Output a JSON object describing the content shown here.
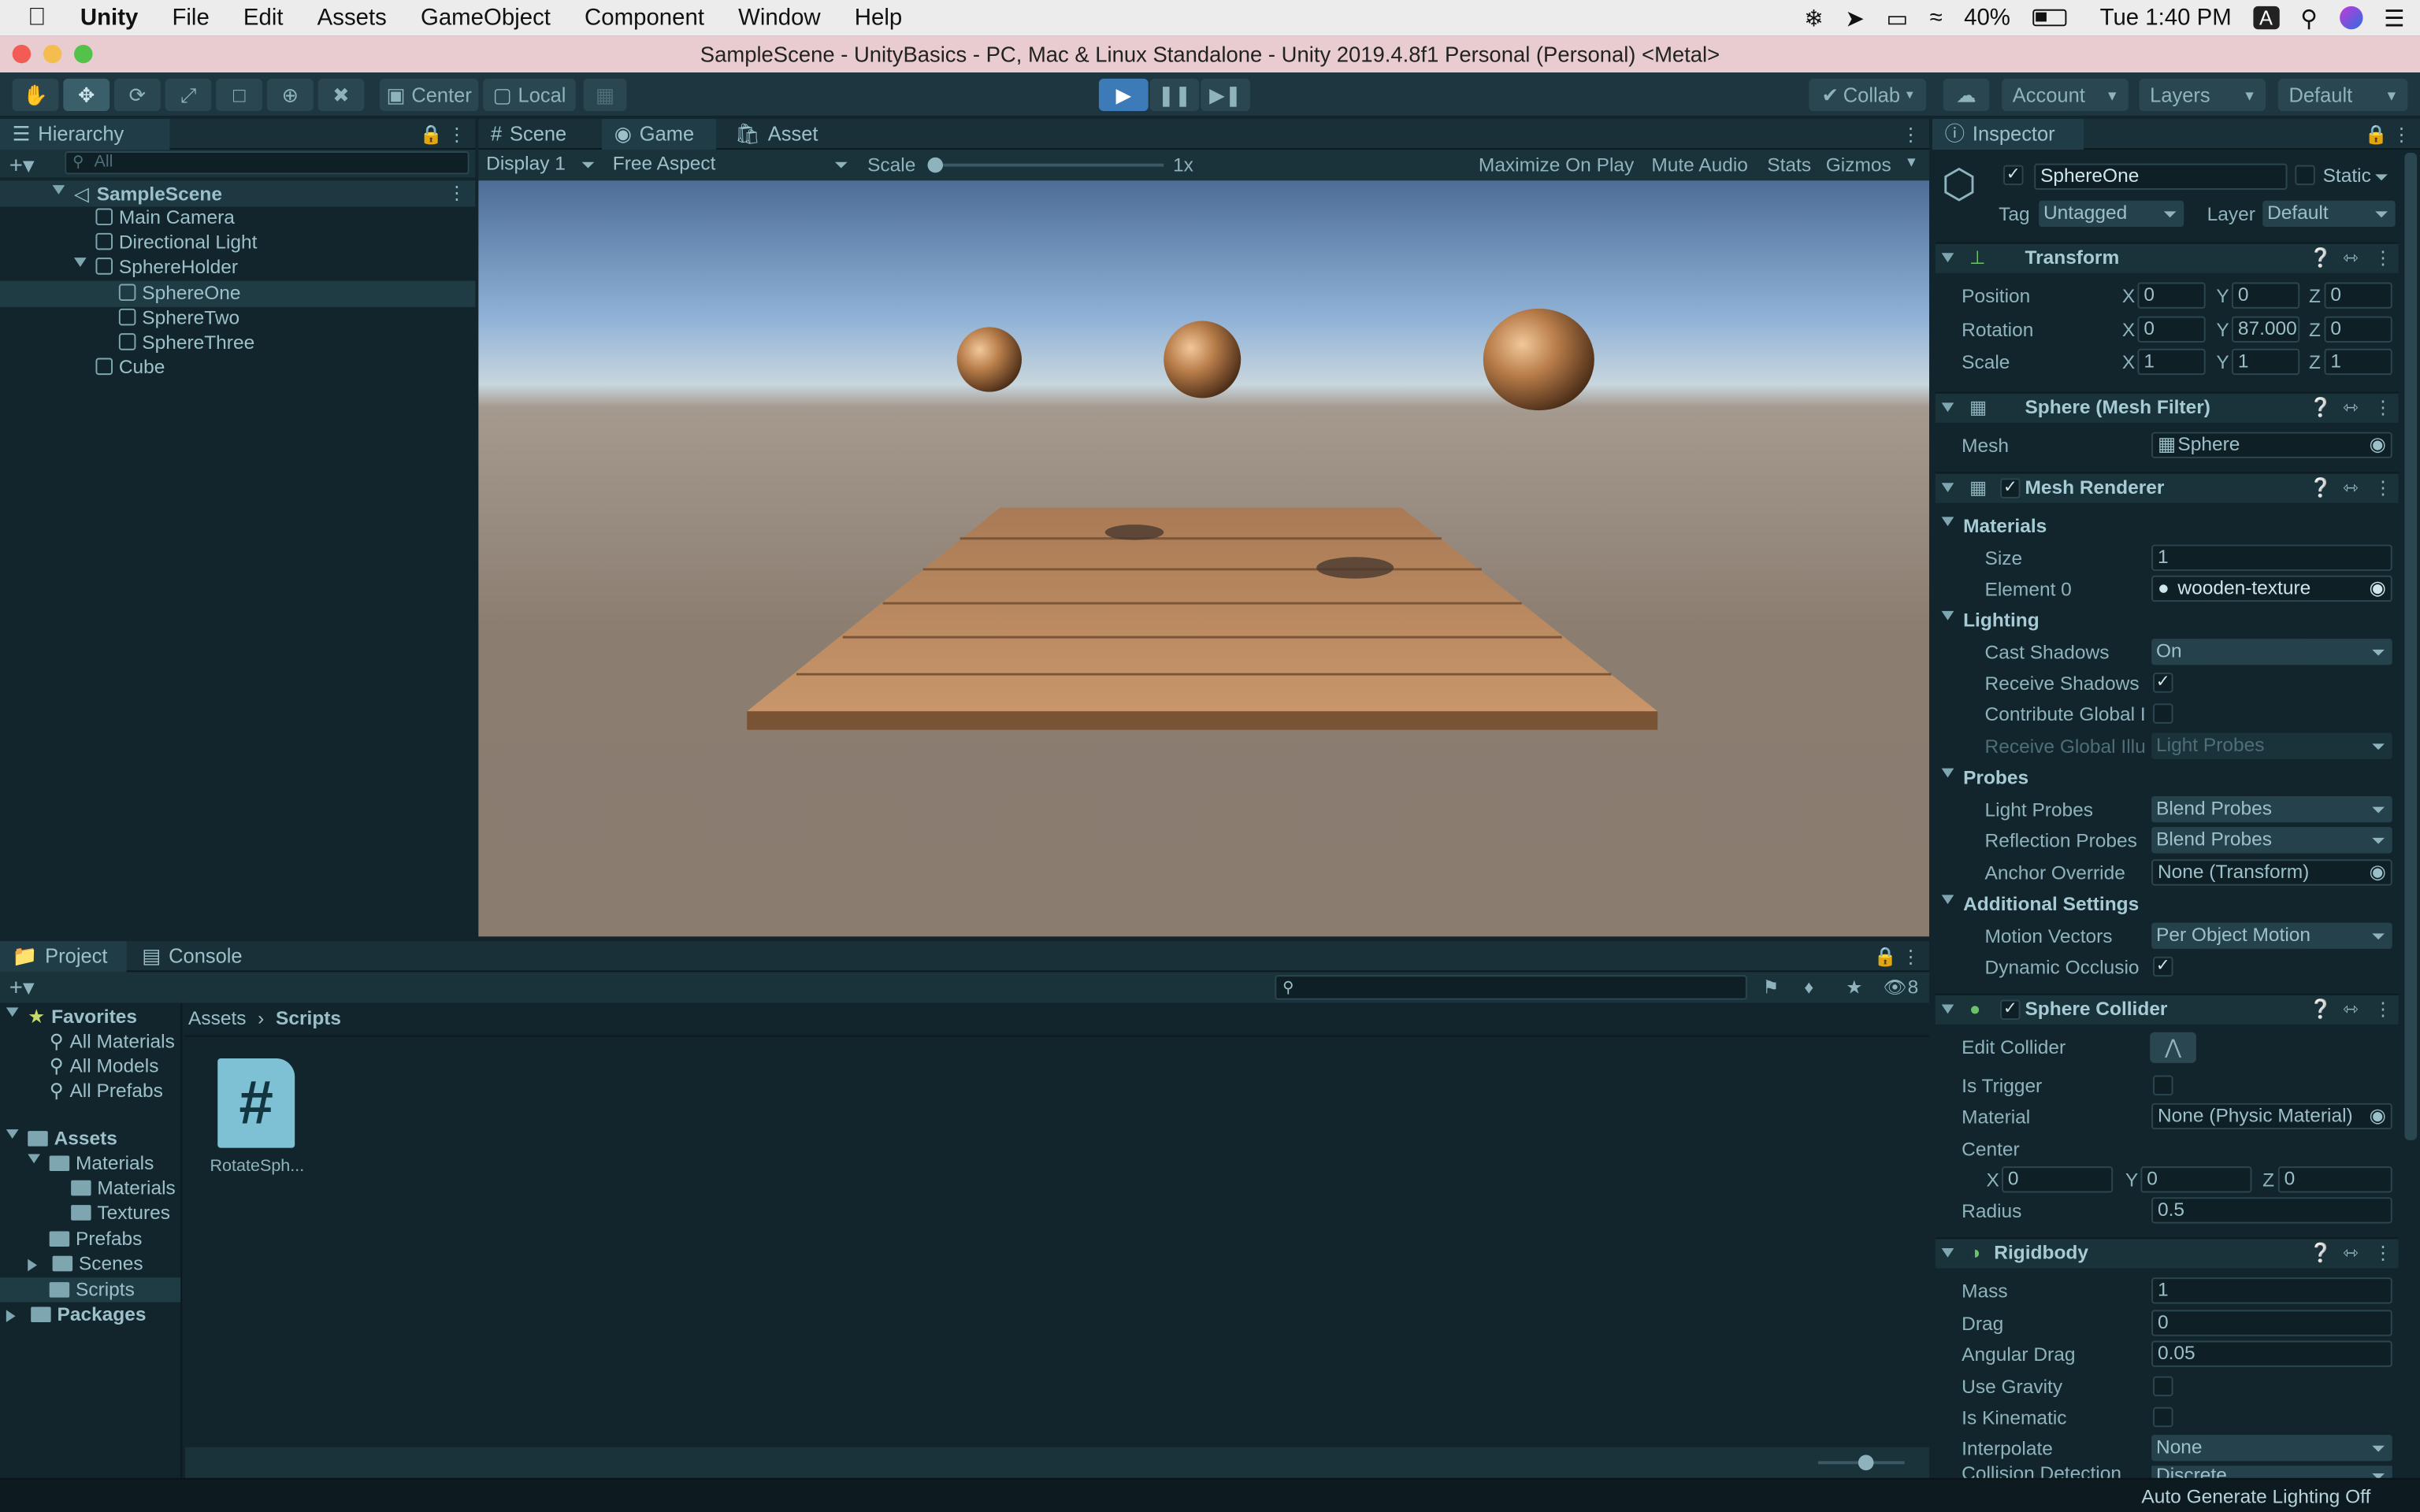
{
  "menubar": {
    "app": "Unity",
    "items": [
      "File",
      "Edit",
      "Assets",
      "GameObject",
      "Component",
      "Window",
      "Help"
    ],
    "battery": "40%",
    "clock": "Tue 1:40 PM",
    "input_source": "A"
  },
  "window_title": "SampleScene - UnityBasics - PC, Mac & Linux Standalone - Unity 2019.4.8f1 Personal (Personal) <Metal>",
  "toolbar": {
    "pivot": "Center",
    "space": "Local",
    "collab": "Collab",
    "account": "Account",
    "layers": "Layers",
    "layout": "Default"
  },
  "hierarchy": {
    "tab": "Hierarchy",
    "search_placeholder": "All",
    "scene": "SampleScene",
    "items": [
      "Main Camera",
      "Directional Light",
      "SphereHolder",
      "SphereOne",
      "SphereTwo",
      "SphereThree",
      "Cube"
    ]
  },
  "center": {
    "tabs": [
      "Scene",
      "Game",
      "Asset Store"
    ],
    "display": "Display 1",
    "aspect": "Free Aspect",
    "scale_label": "Scale",
    "scale_value": "1x",
    "scale_level": 0,
    "buttons": [
      "Maximize On Play",
      "Mute Audio",
      "Stats",
      "Gizmos"
    ]
  },
  "project": {
    "tabs": [
      "Project",
      "Console"
    ],
    "hidden_count": "8",
    "favorites": {
      "label": "Favorites",
      "items": [
        "All Materials",
        "All Models",
        "All Prefabs"
      ]
    },
    "assets": {
      "label": "Assets",
      "items": [
        "Materials",
        "Materials",
        "Textures",
        "Prefabs",
        "Scenes",
        "Scripts"
      ]
    },
    "packages": "Packages",
    "breadcrumb": [
      "Assets",
      "Scripts"
    ],
    "file": "RotateSph..."
  },
  "inspector": {
    "tab": "Inspector",
    "object_name": "SphereOne",
    "static_label": "Static",
    "tag_label": "Tag",
    "tag": "Untagged",
    "layer_label": "Layer",
    "layer": "Default",
    "transform": {
      "title": "Transform",
      "rows": [
        {
          "label": "Position",
          "x": "0",
          "y": "0",
          "z": "0"
        },
        {
          "label": "Rotation",
          "x": "0",
          "y": "87.000",
          "z": "0"
        },
        {
          "label": "Scale",
          "x": "1",
          "y": "1",
          "z": "1"
        }
      ]
    },
    "mesh_filter": {
      "title": "Sphere (Mesh Filter)",
      "mesh_label": "Mesh",
      "mesh": "Sphere"
    },
    "mesh_renderer": {
      "title": "Mesh Renderer",
      "materials": "Materials",
      "size_label": "Size",
      "size": "1",
      "element0_label": "Element 0",
      "element0": "wooden-texture",
      "lighting": "Lighting",
      "cast_shadows_label": "Cast Shadows",
      "cast_shadows": "On",
      "receive_shadows_label": "Receive Shadows",
      "contribute_gi_label": "Contribute Global I",
      "receive_gi_label": "Receive Global Illu",
      "receive_gi": "Light Probes",
      "probes": "Probes",
      "light_probes_label": "Light Probes",
      "light_probes": "Blend Probes",
      "reflection_probes_label": "Reflection Probes",
      "reflection_probes": "Blend Probes",
      "anchor_override_label": "Anchor Override",
      "anchor_override": "None (Transform)",
      "additional": "Additional Settings",
      "motion_vectors_label": "Motion Vectors",
      "motion_vectors": "Per Object Motion",
      "dynamic_occlusion_label": "Dynamic Occlusio"
    },
    "sphere_collider": {
      "title": "Sphere Collider",
      "edit_collider_label": "Edit Collider",
      "is_trigger_label": "Is Trigger",
      "material_label": "Material",
      "material": "None (Physic Material)",
      "center_label": "Center",
      "cx": "0",
      "cy": "0",
      "cz": "0",
      "radius_label": "Radius",
      "radius": "0.5"
    },
    "rigidbody": {
      "title": "Rigidbody",
      "mass_label": "Mass",
      "mass": "1",
      "drag_label": "Drag",
      "drag": "0",
      "angular_drag_label": "Angular Drag",
      "angular_drag": "0.05",
      "use_gravity_label": "Use Gravity",
      "is_kinematic_label": "Is Kinematic",
      "interpolate_label": "Interpolate",
      "interpolate": "None",
      "collision_label": "Collision Detection",
      "collision": "Discrete"
    }
  },
  "status_bar": "Auto Generate Lighting Off"
}
